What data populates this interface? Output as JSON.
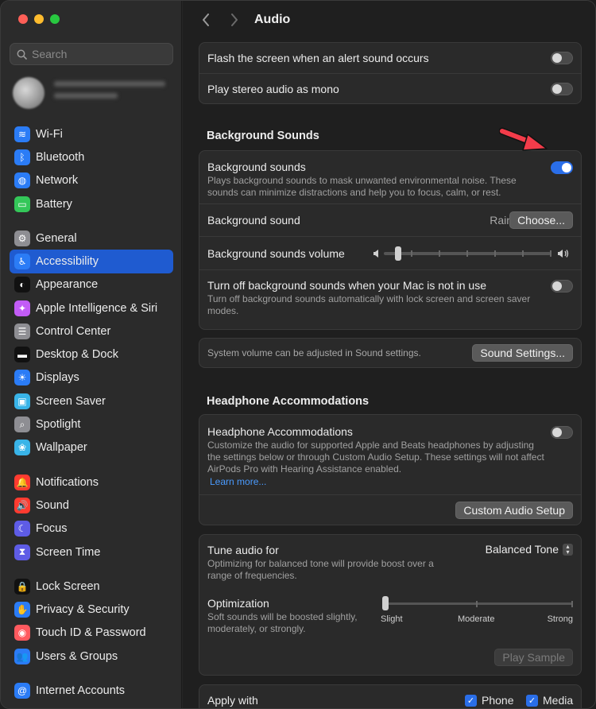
{
  "window": {
    "title": "Audio"
  },
  "sidebar": {
    "search_placeholder": "Search",
    "groups": [
      [
        {
          "label": "Wi-Fi",
          "icon": "wifi-icon",
          "color": "#2b7cf6",
          "glyph": "≋"
        },
        {
          "label": "Bluetooth",
          "icon": "bluetooth-icon",
          "color": "#2b7cf6",
          "glyph": "ᛒ"
        },
        {
          "label": "Network",
          "icon": "globe-icon",
          "color": "#2b7cf6",
          "glyph": "◍"
        },
        {
          "label": "Battery",
          "icon": "battery-icon",
          "color": "#34c759",
          "glyph": "▭"
        }
      ],
      [
        {
          "label": "General",
          "icon": "gear-icon",
          "color": "#8e8e93",
          "glyph": "⚙"
        },
        {
          "label": "Accessibility",
          "icon": "accessibility-icon",
          "color": "#2b7cf6",
          "glyph": "♿",
          "selected": true
        },
        {
          "label": "Appearance",
          "icon": "appearance-icon",
          "color": "#111111",
          "glyph": "◐"
        },
        {
          "label": "Apple Intelligence & Siri",
          "icon": "siri-icon",
          "color": "#c25cf6",
          "glyph": "✦"
        },
        {
          "label": "Control Center",
          "icon": "control-center-icon",
          "color": "#8e8e93",
          "glyph": "☰"
        },
        {
          "label": "Desktop & Dock",
          "icon": "dock-icon",
          "color": "#111111",
          "glyph": "▬"
        },
        {
          "label": "Displays",
          "icon": "sun-icon",
          "color": "#2b7cf6",
          "glyph": "☀"
        },
        {
          "label": "Screen Saver",
          "icon": "screen-saver-icon",
          "color": "#39b4e8",
          "glyph": "▣"
        },
        {
          "label": "Spotlight",
          "icon": "spotlight-icon",
          "color": "#8e8e93",
          "glyph": "⌕"
        },
        {
          "label": "Wallpaper",
          "icon": "wallpaper-icon",
          "color": "#39b4e8",
          "glyph": "❀"
        }
      ],
      [
        {
          "label": "Notifications",
          "icon": "bell-icon",
          "color": "#ff3b30",
          "glyph": "🔔"
        },
        {
          "label": "Sound",
          "icon": "speaker-icon",
          "color": "#ff3b30",
          "glyph": "🔊"
        },
        {
          "label": "Focus",
          "icon": "moon-icon",
          "color": "#5e5ce6",
          "glyph": "☾"
        },
        {
          "label": "Screen Time",
          "icon": "hourglass-icon",
          "color": "#5e5ce6",
          "glyph": "⧗"
        }
      ],
      [
        {
          "label": "Lock Screen",
          "icon": "lock-icon",
          "color": "#111111",
          "glyph": "🔒"
        },
        {
          "label": "Privacy & Security",
          "icon": "hand-icon",
          "color": "#2b7cf6",
          "glyph": "✋"
        },
        {
          "label": "Touch ID & Password",
          "icon": "fingerprint-icon",
          "color": "#ff5a5f",
          "glyph": "◉"
        },
        {
          "label": "Users & Groups",
          "icon": "users-icon",
          "color": "#2b7cf6",
          "glyph": "👥"
        }
      ],
      [
        {
          "label": "Internet Accounts",
          "icon": "at-icon",
          "color": "#2b7cf6",
          "glyph": "@"
        }
      ]
    ]
  },
  "main": {
    "top_rows": {
      "flash_label": "Flash the screen when an alert sound occurs",
      "mono_label": "Play stereo audio as mono"
    },
    "bg_section_title": "Background Sounds",
    "bg": {
      "toggle_label": "Background sounds",
      "toggle_desc": "Plays background sounds to mask unwanted environmental noise. These sounds can minimize distractions and help you to focus, calm, or rest.",
      "sound_label": "Background sound",
      "sound_value": "Rain",
      "choose_button": "Choose...",
      "volume_label": "Background sounds volume",
      "volume_level": 0.05,
      "turnoff_label": "Turn off background sounds when your Mac is not in use",
      "turnoff_desc": "Turn off background sounds automatically with lock screen and screen saver modes."
    },
    "system_volume": {
      "text": "System volume can be adjusted in Sound settings.",
      "button": "Sound Settings..."
    },
    "hp_section_title": "Headphone Accommodations",
    "hp": {
      "label": "Headphone Accommodations",
      "desc": "Customize the audio for supported Apple and Beats headphones by adjusting the settings below or through Custom Audio Setup. These settings will not affect AirPods Pro with Hearing Assistance enabled.",
      "learn_more": "Learn more...",
      "custom_button": "Custom Audio Setup"
    },
    "tune": {
      "label": "Tune audio for",
      "desc": "Optimizing for balanced tone will provide boost over a range of frequencies.",
      "value": "Balanced Tone",
      "opt_label": "Optimization",
      "opt_desc": "Soft sounds will be boosted slightly, moderately, or strongly.",
      "opt_slight": "Slight",
      "opt_moderate": "Moderate",
      "opt_strong": "Strong",
      "opt_level": 0,
      "play_sample": "Play Sample"
    },
    "apply": {
      "label": "Apply with",
      "phone": "Phone",
      "media": "Media"
    }
  }
}
